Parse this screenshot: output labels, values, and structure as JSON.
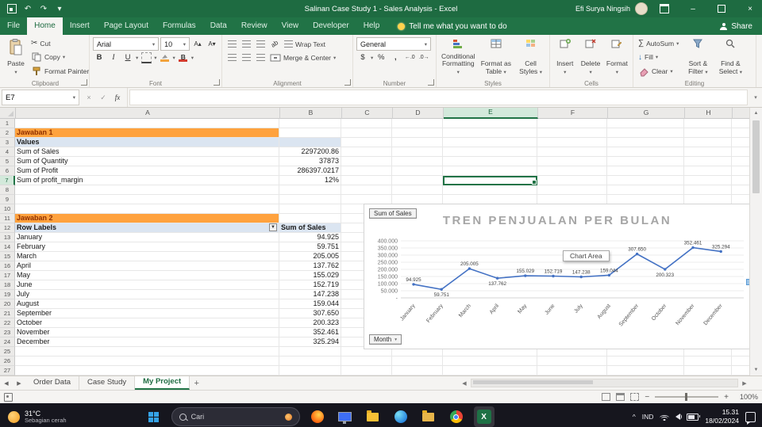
{
  "titlebar": {
    "title": "Salinan Case Study 1 - Sales Analysis - Excel",
    "user": "Efi Surya Ningsih"
  },
  "ribbon": {
    "tabs": [
      "File",
      "Home",
      "Insert",
      "Page Layout",
      "Formulas",
      "Data",
      "Review",
      "View",
      "Developer",
      "Help"
    ],
    "active_tab": "Home",
    "tell_me": "Tell me what you want to do",
    "share": "Share",
    "groups": {
      "clipboard": {
        "label": "Clipboard",
        "paste": "Paste",
        "cut": "Cut",
        "copy": "Copy",
        "format_painter": "Format Painter"
      },
      "font": {
        "label": "Font",
        "font_name": "Arial",
        "font_size": "10"
      },
      "alignment": {
        "label": "Alignment",
        "wrap_text": "Wrap Text",
        "merge_center": "Merge & Center"
      },
      "number": {
        "label": "Number",
        "format": "General"
      },
      "styles": {
        "label": "Styles",
        "conditional": "Conditional Formatting",
        "format_table": "Format as Table",
        "cell_styles": "Cell Styles"
      },
      "cells": {
        "label": "Cells",
        "insert": "Insert",
        "delete": "Delete",
        "format": "Format"
      },
      "editing": {
        "label": "Editing",
        "autosum": "AutoSum",
        "fill": "Fill",
        "clear": "Clear",
        "sort_filter": "Sort & Filter",
        "find_select": "Find & Select"
      }
    }
  },
  "formula_bar": {
    "name_box": "E7",
    "formula": ""
  },
  "sheet": {
    "columns": [
      "A",
      "B",
      "C",
      "D",
      "E",
      "F",
      "G",
      "H"
    ],
    "selected_cell": {
      "col": "E",
      "row": 7
    },
    "jawaban1": {
      "title": "Jawaban 1",
      "subtitle": "Values",
      "items": [
        {
          "label": "Sum of Sales",
          "value": "2297200.86"
        },
        {
          "label": "Sum of Quantity",
          "value": "37873"
        },
        {
          "label": "Sum of Profit",
          "value": "286397.0217"
        },
        {
          "label": "Sum of profit_margin",
          "value": "12%"
        }
      ]
    },
    "jawaban2": {
      "title": "Jawaban 2",
      "col_label": "Row Labels",
      "col_value": "Sum of Sales",
      "items": [
        {
          "label": "January",
          "value": "94.925"
        },
        {
          "label": "February",
          "value": "59.751"
        },
        {
          "label": "March",
          "value": "205.005"
        },
        {
          "label": "April",
          "value": "137.762"
        },
        {
          "label": "May",
          "value": "155.029"
        },
        {
          "label": "June",
          "value": "152.719"
        },
        {
          "label": "July",
          "value": "147.238"
        },
        {
          "label": "August",
          "value": "159.044"
        },
        {
          "label": "September",
          "value": "307.650"
        },
        {
          "label": "October",
          "value": "200.323"
        },
        {
          "label": "November",
          "value": "352.461"
        },
        {
          "label": "December",
          "value": "325.294"
        }
      ]
    }
  },
  "chart_data": {
    "type": "line",
    "title": "TREN PENJUALAN PER BULAN",
    "field_button_top": "Sum of Sales",
    "field_button_bottom": "Month",
    "tooltip": "Chart Area",
    "categories": [
      "January",
      "February",
      "March",
      "April",
      "May",
      "June",
      "July",
      "August",
      "September",
      "October",
      "November",
      "December"
    ],
    "values": [
      94925,
      59751,
      205005,
      137762,
      155029,
      152719,
      147238,
      159044,
      307650,
      200323,
      352461,
      325294
    ],
    "labels": [
      "94.925",
      "59.751",
      "205.005",
      "137.762",
      "155.029",
      "152.719",
      "147.238",
      "159.044",
      "307.650",
      "200.323",
      "352.461",
      "325.294"
    ],
    "ylim": [
      0,
      400000
    ],
    "ytick_step": 50000,
    "ytick_labels": [
      "400.000",
      "350.000",
      "300.000",
      "250.000",
      "200.000",
      "150.000",
      "100.000",
      "50.000",
      "-"
    ],
    "series_color": "#4472C4",
    "grid": true,
    "legend_position": "none"
  },
  "sheet_tabs": {
    "tabs": [
      "Order Data",
      "Case Study",
      "My Project"
    ],
    "active": "My Project"
  },
  "status_bar": {
    "zoom": "100%"
  },
  "taskbar": {
    "weather": {
      "temp": "31°C",
      "desc": "Sebagian cerah"
    },
    "search_label": "Cari",
    "tray": {
      "lang": "IND",
      "time": "15.31",
      "date": "18/02/2024"
    }
  },
  "icons": {
    "dropdown": "▾",
    "cut": "✂",
    "sigma": "∑",
    "bold": "B",
    "italic": "I",
    "underline": "U",
    "percent": "%",
    "comma": ",",
    "currency": "$",
    "undo": "↶",
    "redo": "↷",
    "check": "✓",
    "cancel": "×",
    "fx": "fx",
    "nav_left": "◀",
    "nav_right": "▶",
    "scroll_up": "▲",
    "scroll_down": "▼",
    "plus": "+",
    "minus": "−",
    "close": "×",
    "minimize": "–",
    "caret": "^",
    "grow_font": "A▴",
    "shrink_font": "A▾",
    "fill_arrow": "↓",
    "filter": "▼"
  }
}
